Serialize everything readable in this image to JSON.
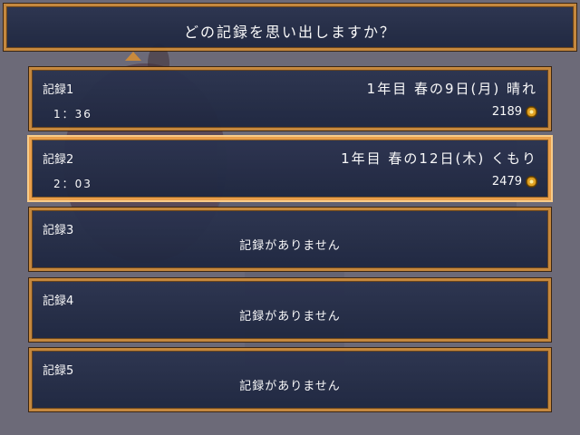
{
  "header": {
    "title": "どの記録を思い出しますか？"
  },
  "colors": {
    "panel_border": "#c98a3c",
    "panel_bg": "#1f2740",
    "coin": "#e6a520"
  },
  "slots": [
    {
      "label": "記録1",
      "time": "1：36",
      "date": "1年目 春の9日(月) 晴れ",
      "money": "2189",
      "selected": false
    },
    {
      "label": "記録2",
      "time": "2：03",
      "date": "1年目 春の12日(木) くもり",
      "money": "2479",
      "selected": true
    },
    {
      "label": "記録3",
      "empty_text": "記録がありません"
    },
    {
      "label": "記録4",
      "empty_text": "記録がありません"
    },
    {
      "label": "記録5",
      "empty_text": "記録がありません"
    }
  ]
}
